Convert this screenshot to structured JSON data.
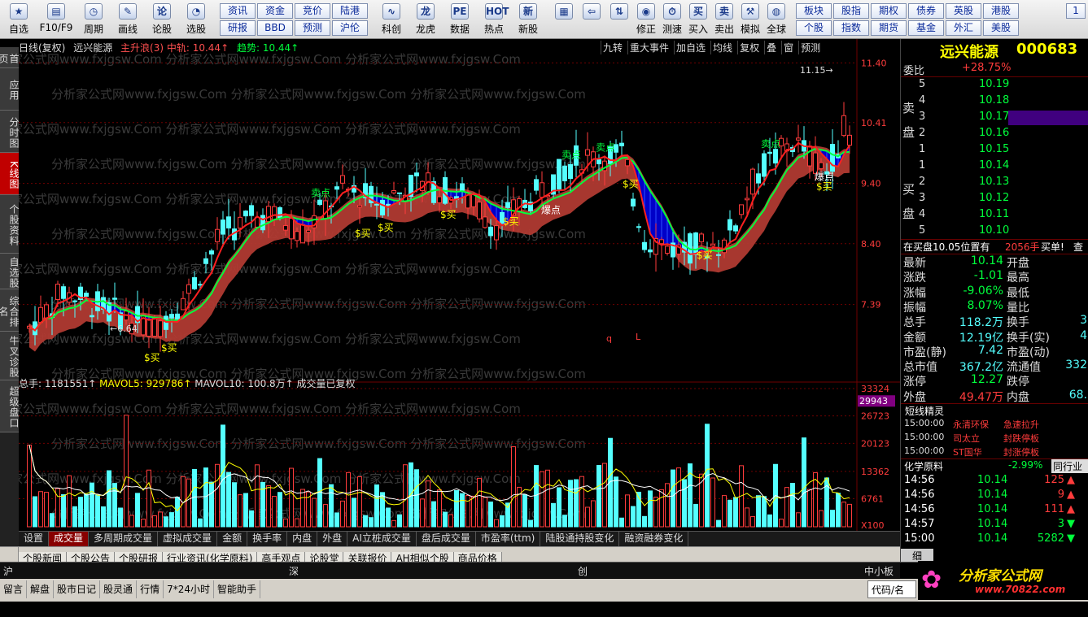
{
  "toolbar": {
    "icon_items": [
      {
        "label": "自选",
        "icon": "star-icon",
        "glyph": "★"
      },
      {
        "label": "F10/F9",
        "icon": "document-icon",
        "glyph": "▤"
      },
      {
        "label": "周期",
        "icon": "clock-icon",
        "glyph": "◷"
      },
      {
        "label": "画线",
        "icon": "pen-icon",
        "glyph": "✎"
      },
      {
        "label": "论股",
        "icon": "chat-icon",
        "glyph": "论"
      },
      {
        "label": "选股",
        "icon": "search-stock-icon",
        "glyph": "◔"
      }
    ],
    "grid_row1": [
      "资讯",
      "资金",
      "竞价",
      "陆港"
    ],
    "grid_row2": [
      "研报",
      "BBD",
      "预测",
      "沪伦"
    ],
    "icon_items2": [
      {
        "label": "科创",
        "icon": "chart-icon",
        "glyph": "∿"
      },
      {
        "label": "龙虎",
        "icon": "dragon-icon",
        "glyph": "龙"
      },
      {
        "label": "数据",
        "icon": "pe-icon",
        "glyph": "PE"
      },
      {
        "label": "热点",
        "icon": "hot-icon",
        "glyph": "HOT"
      },
      {
        "label": "新股",
        "icon": "new-stock-icon",
        "glyph": "新"
      }
    ],
    "icon_items3": [
      {
        "label": "",
        "icon": "color-grid-icon",
        "glyph": "▦"
      },
      {
        "label": "",
        "icon": "back-arrow-icon",
        "glyph": "⇦"
      },
      {
        "label": "",
        "icon": "updown-arrow-icon",
        "glyph": "⇅"
      },
      {
        "label": "修正",
        "icon": "fix-icon",
        "glyph": "◉"
      },
      {
        "label": "测速",
        "icon": "speed-icon",
        "glyph": "⏱"
      },
      {
        "label": "买入",
        "icon": "buy-icon",
        "glyph": "买"
      },
      {
        "label": "卖出",
        "icon": "sell-icon",
        "glyph": "卖"
      },
      {
        "label": "模拟",
        "icon": "hammer-icon",
        "glyph": "⚒"
      },
      {
        "label": "全球",
        "icon": "globe-icon",
        "glyph": "◍"
      }
    ],
    "grid2_row1": [
      "板块",
      "股指",
      "期权",
      "债券",
      "英股",
      "港股"
    ],
    "grid2_row2": [
      "个股",
      "指数",
      "期货",
      "基金",
      "外汇",
      "美股"
    ],
    "more": "1"
  },
  "leftnav": [
    "首页",
    "应用",
    "分时图",
    "K线图",
    "个股资料",
    "自选股",
    "综合排名",
    "牛叉诊股",
    "超级盘口"
  ],
  "chart": {
    "title": "日线(复权)",
    "stock": "远兴能源",
    "ind1": "主升浪(3) 中轨: 10.44↑",
    "ind2": "趋势: 10.44↑",
    "buttons": [
      "九转",
      "重大事件",
      "加自选",
      "均线",
      "复权",
      "叠",
      "窗",
      "预测"
    ],
    "price_axis": [
      "11.40",
      "10.41",
      "9.40",
      "8.40",
      "7.39"
    ],
    "high_label": "11.15",
    "low_label": "6.64",
    "vol_header": {
      "total": "总手: 1181551↑",
      "mavol5": "MAVOL5: 929786↑",
      "mavol10": "MAVOL10: 100.8万↑",
      "note": "成交量已复权"
    },
    "vol_axis": [
      "33324",
      "26723",
      "20123",
      "13362",
      "6761",
      "X100"
    ],
    "vol_current": "29943",
    "watermark": "分析家公式网www.fxjgsw.Com",
    "markers": [
      "q",
      "L"
    ],
    "buy_sign": "$买",
    "sell_sign": "卖点",
    "burst_sign": "爆点"
  },
  "right": {
    "title": "远兴能源",
    "code": "000683",
    "weibi_label": "委比",
    "weibi": "+28.75%",
    "sell_label": "卖盘",
    "buy_label": "买盘",
    "sell": [
      {
        "n": "5",
        "p": "10.19"
      },
      {
        "n": "4",
        "p": "10.18"
      },
      {
        "n": "3",
        "p": "10.17"
      },
      {
        "n": "2",
        "p": "10.16"
      },
      {
        "n": "1",
        "p": "10.15"
      }
    ],
    "buy": [
      {
        "n": "1",
        "p": "10.14"
      },
      {
        "n": "2",
        "p": "10.13"
      },
      {
        "n": "3",
        "p": "10.12"
      },
      {
        "n": "4",
        "p": "10.11"
      },
      {
        "n": "5",
        "p": "10.10"
      }
    ],
    "notice": "在买盘10.05位置有",
    "notice_vol": "2056手",
    "notice_end": "买单!",
    "notice_more": "查",
    "stats": [
      [
        "最新",
        "10.14",
        "开盘"
      ],
      [
        "涨跌",
        "-1.01",
        "最高"
      ],
      [
        "涨幅",
        "-9.06%",
        "最低"
      ],
      [
        "振幅",
        "8.07%",
        "量比"
      ],
      [
        "总手",
        "118.2万",
        "换手"
      ],
      [
        "金额",
        "12.19亿",
        "换手(实)"
      ],
      [
        "市盈(静)",
        "7.42",
        "市盈(动)"
      ],
      [
        "总市值",
        "367.2亿",
        "流通值"
      ],
      [
        "涨停",
        "12.27",
        "跌停"
      ],
      [
        "外盘",
        "49.47万",
        "内盘"
      ]
    ],
    "stats_right": [
      "",
      "",
      "",
      "",
      "3",
      "4",
      "",
      "332",
      "",
      "68."
    ],
    "spirit_title": "短线精灵",
    "spirit": [
      [
        "15:00:00",
        "永清环保",
        "急速拉升"
      ],
      [
        "15:00:00",
        "司太立",
        "封跌停板"
      ],
      [
        "15:00:00",
        "ST国华",
        "封涨停板"
      ]
    ],
    "sector": "化学原料",
    "sector_pct": "-2.99%",
    "sector_tab": "同行业",
    "ticks": [
      [
        "14:56",
        "10.14",
        "125"
      ],
      [
        "14:56",
        "10.14",
        "9"
      ],
      [
        "14:56",
        "10.14",
        "111"
      ],
      [
        "14:57",
        "10.14",
        "3"
      ],
      [
        "15:00",
        "10.14",
        "5282"
      ]
    ],
    "tick_dir": [
      "up",
      "up",
      "up",
      "down",
      "down"
    ],
    "sub_tab": "细"
  },
  "bottom_tabs": [
    "设置",
    "成交量",
    "多周期成交量",
    "虚拟成交量",
    "金额",
    "换手率",
    "内盘",
    "外盘",
    "AI立桩成交量",
    "盘后成交量",
    "市盈率(ttm)",
    "陆股通持股变化",
    "融资融券变化"
  ],
  "news_tabs": [
    "个股新闻",
    "个股公告",
    "个股研报",
    "行业资讯(化学原料)",
    "高手观点",
    "论股堂",
    "关联报价",
    "AH相似个股",
    "商品价格"
  ],
  "index_bar": [
    "沪",
    "深",
    "创",
    "中小板指"
  ],
  "status_items": [
    "留言",
    "解盘",
    "股市日记",
    "股灵通",
    "行情",
    "7*24小时",
    "智能助手"
  ],
  "status_code": "代码/名称",
  "logo_text": "分析家公式网",
  "logo_url": "www.70822.com",
  "colors": {
    "up": "#ff3c3c",
    "down": "#54ffff",
    "green": "#00ff3c",
    "band": "#b03a32",
    "fill": "#0000c8",
    "yellow": "#ffff00"
  }
}
